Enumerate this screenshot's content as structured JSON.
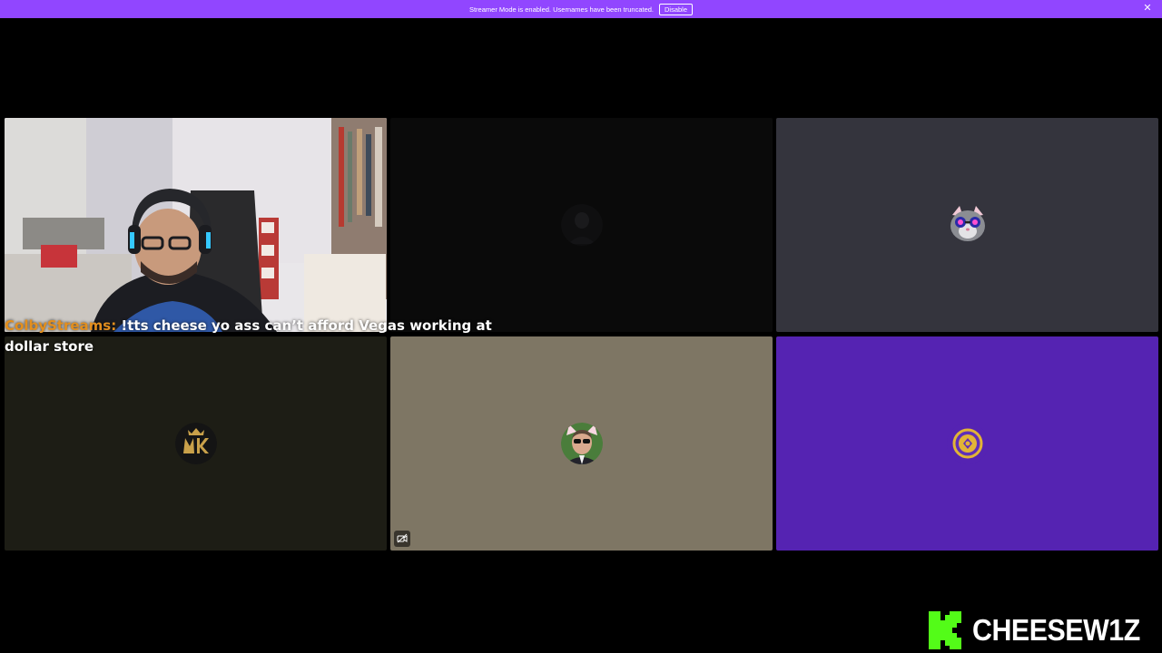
{
  "banner": {
    "message": "Streamer Mode is enabled. Usernames have been truncated.",
    "button_label": "Disable",
    "close_glyph": "✕",
    "color": "#9146ff"
  },
  "tiles": [
    {
      "name": "webcam-feed",
      "bg": "#e4e2e5"
    },
    {
      "name": "participant-2",
      "bg": "#0a0a0a"
    },
    {
      "name": "participant-3",
      "bg": "#34343d"
    },
    {
      "name": "participant-4",
      "bg": "#1d1d15"
    },
    {
      "name": "participant-5",
      "bg": "#7e7664"
    },
    {
      "name": "participant-6",
      "bg": "#5523b2"
    }
  ],
  "chat": {
    "username": "ColbyStreams:",
    "message": " !tts cheese yo ass can’t afford Vegas working at dollar store",
    "username_color": "#e38f1e"
  },
  "avatars": {
    "participant_3": "cat-with-sunglasses-avatar",
    "participant_4": "mk-logo-avatar",
    "participant_5": "man-with-cat-ears-avatar",
    "participant_6": "gold-token-avatar"
  },
  "brand": {
    "logo": "kick-logo",
    "logo_color": "#53fc18",
    "name": "CHEESEW1Z"
  }
}
